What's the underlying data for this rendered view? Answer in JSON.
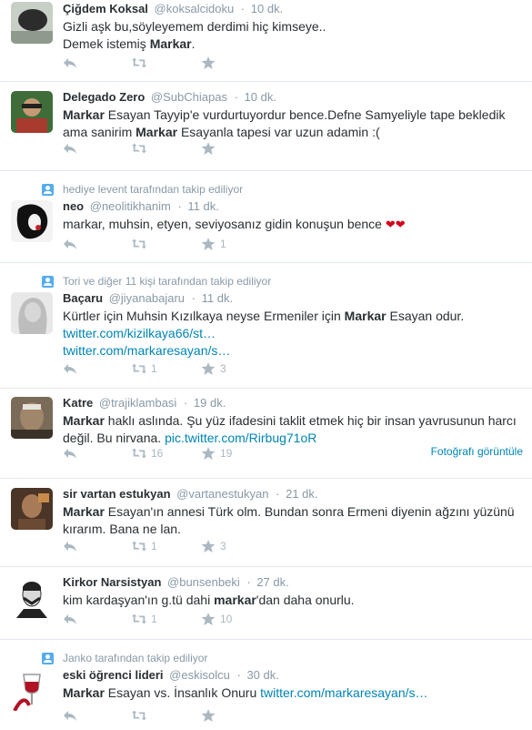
{
  "tweets": [
    {
      "context": "",
      "name": "Çiğdem Koksal",
      "handle": "@koksalcidoku",
      "time": "10 dk.",
      "text_html": "Gizli aşk bu,söyleyemem derdimi hiç kimseye..<br>Demek istemiş <b>Markar</b>.",
      "retweets": "",
      "favorites": "",
      "photo_link": ""
    },
    {
      "context": "",
      "name": "Delegado Zero",
      "handle": "@SubChiapas",
      "time": "10 dk.",
      "text_html": "<b>Markar</b> Esayan Tayyip'e vurdurtuyordur bence.Defne Samyeliyle tape bekledik ama sanirim <b>Markar</b> Esayanla tapesi var uzun adamin :(",
      "retweets": "",
      "favorites": "",
      "photo_link": ""
    },
    {
      "context": "hediye levent tarafından takip ediliyor",
      "name": "neo",
      "handle": "@neolitikhanim",
      "time": "11 dk.",
      "text_html": "markar, muhsin, etyen, seviyosanız gidin konuşun bence <span class=\"heart\">❤❤</span>",
      "retweets": "",
      "favorites": "1",
      "photo_link": ""
    },
    {
      "context": "Tori ve diğer 11 kişi tarafından takip ediliyor",
      "name": "Baçaru",
      "handle": "@jiyanabajaru",
      "time": "11 dk.",
      "text_html": "Kürtler için Muhsin Kızılkaya neyse Ermeniler için <b>Markar</b> Esayan odur.<br><span class=\"link\">twitter.com/kizilkaya66/st…</span><br><span class=\"link\">twitter.com/markaresayan/s…</span>",
      "retweets": "1",
      "favorites": "3",
      "photo_link": ""
    },
    {
      "context": "",
      "name": "Katre",
      "handle": "@trajiklambasi",
      "time": "19 dk.",
      "text_html": "<b>Markar</b> haklı aslında. Şu yüz ifadesini taklit etmek hiç bir insan yavrusunun harcı değil. Bu nirvana. <span class=\"link\">pic.twitter.com/Rirbug71oR</span>",
      "retweets": "16",
      "favorites": "19",
      "photo_link": "Fotoğrafı görüntüle"
    },
    {
      "context": "",
      "name": "sir vartan estukyan",
      "handle": "@vartanestukyan",
      "time": "21 dk.",
      "text_html": "<b>Markar</b> Esayan'ın annesi Türk olm. Bundan sonra Ermeni diyenin ağzını yüzünü kırarım. Bana ne lan.",
      "retweets": "1",
      "favorites": "3",
      "photo_link": ""
    },
    {
      "context": "",
      "name": "Kirkor Narsistyan",
      "handle": "@bunsenbeki",
      "time": "27 dk.",
      "text_html": "kim kardaşyan'ın g.tü dahi <b>markar</b>'dan daha onurlu.",
      "retweets": "1",
      "favorites": "10",
      "photo_link": ""
    },
    {
      "context": "Janko tarafından takip ediliyor",
      "name": "eski öğrenci lideri",
      "handle": "@eskisolcu",
      "time": "30 dk.",
      "text_html": "<b>Markar</b> Esayan vs. İnsanlık Onuru <span class=\"link\">twitter.com/markaresayan/s…</span>",
      "retweets": "",
      "favorites": "",
      "photo_link": ""
    }
  ]
}
